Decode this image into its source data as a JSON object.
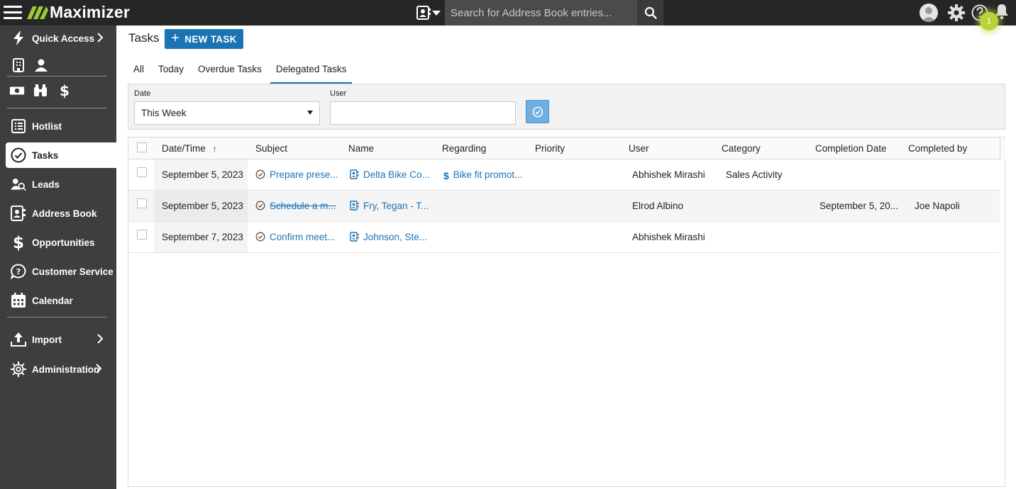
{
  "app": {
    "name": "Maximizer",
    "search_placeholder": "Search for Address Book entries...",
    "notification_count": "1"
  },
  "sidebar": {
    "quick_access": "Quick Access",
    "items": [
      {
        "label": "Hotlist",
        "icon": "hotlist-icon"
      },
      {
        "label": "Tasks",
        "icon": "check-circle-icon"
      },
      {
        "label": "Leads",
        "icon": "leads-icon"
      },
      {
        "label": "Address Book",
        "icon": "address-book-icon"
      },
      {
        "label": "Opportunities",
        "icon": "dollar-icon"
      },
      {
        "label": "Customer Service",
        "icon": "customer-service-icon"
      },
      {
        "label": "Calendar",
        "icon": "calendar-icon"
      }
    ],
    "import": "Import",
    "administration": "Administration"
  },
  "page": {
    "title": "Tasks",
    "new_task": "NEW TASK",
    "tabs": [
      "All",
      "Today",
      "Overdue Tasks",
      "Delegated Tasks"
    ],
    "active_tab": "Delegated Tasks"
  },
  "filters": {
    "date_label": "Date",
    "date_value": "This Week",
    "user_label": "User",
    "user_value": ""
  },
  "grid": {
    "columns": [
      "Date/Time",
      "Subject",
      "Name",
      "Regarding",
      "Priority",
      "User",
      "Category",
      "Completion Date",
      "Completed by"
    ],
    "sort_indicator": "↑",
    "rows": [
      {
        "datetime": "September 5, 2023",
        "subject": "Prepare prese...",
        "completed": false,
        "name": "Delta Bike Co...",
        "regarding": "Bike fit promot...",
        "priority": "",
        "user": "Abhishek Mirashi",
        "category": "Sales Activity",
        "completion_date": "",
        "completed_by": ""
      },
      {
        "datetime": "September 5, 2023",
        "subject": "Schedule a m...",
        "completed": true,
        "name": "Fry, Tegan - T...",
        "regarding": "",
        "priority": "",
        "user": "Elrod Albino",
        "category": "",
        "completion_date": "September 5, 20...",
        "completed_by": "Joe Napoli"
      },
      {
        "datetime": "September 7, 2023",
        "subject": "Confirm meet...",
        "completed": false,
        "name": "Johnson, Ste...",
        "regarding": "",
        "priority": "",
        "user": "Abhishek Mirashi",
        "category": "",
        "completion_date": "",
        "completed_by": ""
      }
    ]
  },
  "colors": {
    "accent": "#1b73b4",
    "topbar": "#262626",
    "sidebar": "#3d3e40",
    "badge": "#b9d43a",
    "logo_green": "#9bcb3c"
  }
}
